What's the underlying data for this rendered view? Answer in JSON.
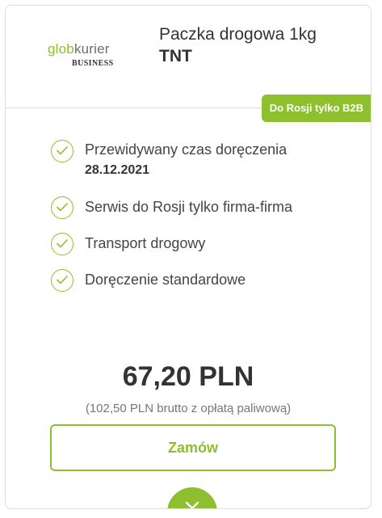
{
  "logo": {
    "part1": "glob",
    "part2": "kurier",
    "sub": "BUSINESS"
  },
  "offer": {
    "title": "Paczka drogowa 1kg",
    "carrier": "TNT",
    "badge": "Do Rosji tylko B2B"
  },
  "features": [
    {
      "label": "Przewidywany czas doręczenia",
      "value": "28.12.2021"
    },
    {
      "label": "Serwis do Rosji tylko firma-firma"
    },
    {
      "label": "Transport drogowy"
    },
    {
      "label": "Doręczenie standardowe"
    }
  ],
  "price": {
    "net": "67,20 PLN",
    "gross_note": "(102,50 PLN brutto z opłatą paliwową)"
  },
  "actions": {
    "order_label": "Zamów"
  },
  "icons": {
    "feature": "check-circle-icon",
    "expand": "chevron-down-icon"
  },
  "colors": {
    "accent": "#8dbf2e",
    "text": "#333333",
    "muted": "#777777",
    "border": "#dcdcdc"
  }
}
